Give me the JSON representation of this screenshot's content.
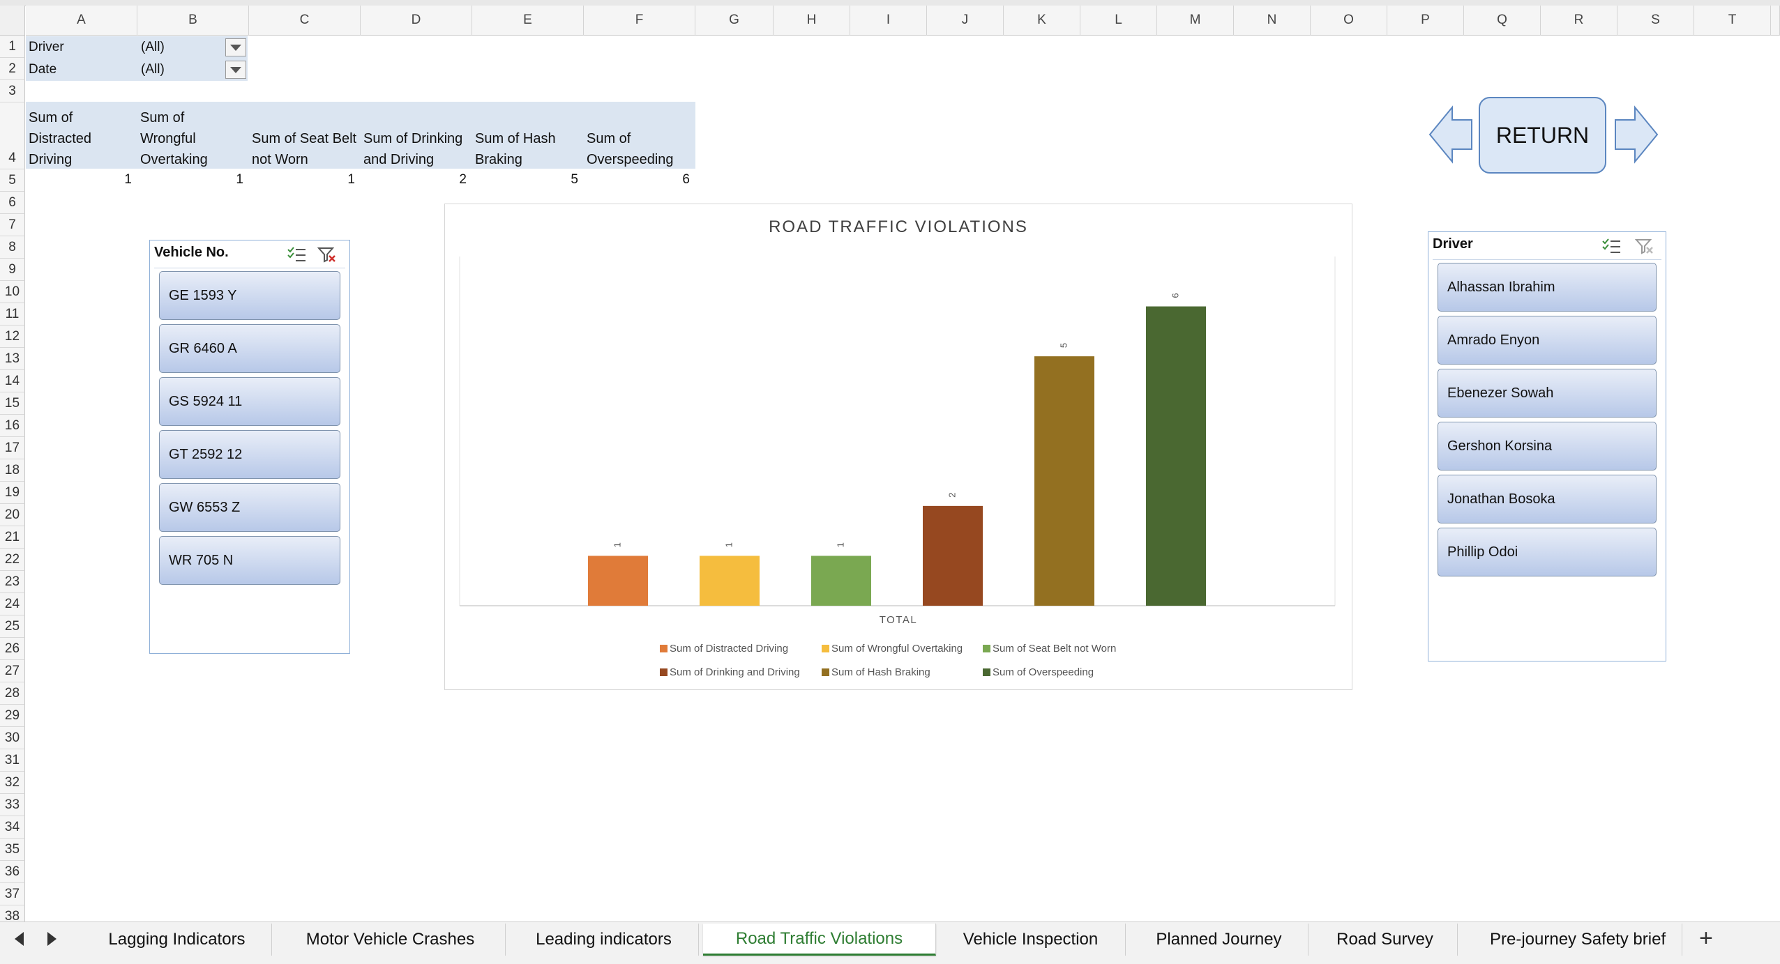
{
  "columns": [
    "A",
    "B",
    "C",
    "D",
    "E",
    "F",
    "G",
    "H",
    "I",
    "J",
    "K",
    "L",
    "M",
    "N",
    "O",
    "P",
    "Q",
    "R",
    "S",
    "T"
  ],
  "rows": [
    "1",
    "2",
    "3",
    "4",
    "5",
    "6",
    "7",
    "8",
    "9",
    "10",
    "11",
    "12",
    "13",
    "14",
    "15",
    "16",
    "17",
    "18",
    "19",
    "20",
    "21",
    "22",
    "23",
    "24",
    "25",
    "26",
    "27",
    "28",
    "29",
    "30",
    "31",
    "32",
    "33",
    "34",
    "35",
    "36",
    "37",
    "38"
  ],
  "filters": [
    {
      "label": "Driver",
      "value": "(All)"
    },
    {
      "label": "Date",
      "value": "(All)"
    }
  ],
  "pivot": {
    "headers": [
      "Sum of Distracted Driving",
      "Sum of Wrongful Overtaking",
      "Sum of Seat Belt not Worn",
      "Sum of Drinking and Driving",
      "Sum of Hash Braking",
      "Sum of Overspeeding"
    ],
    "header_lines": [
      [
        "Sum of",
        "Distracted",
        "Driving"
      ],
      [
        "Sum of",
        "Wrongful",
        "Overtaking"
      ],
      [
        "Sum of Seat Belt",
        "not Worn"
      ],
      [
        "Sum of Drinking",
        "and Driving"
      ],
      [
        "Sum of Hash",
        "Braking"
      ],
      [
        "Sum of",
        "Overspeeding"
      ]
    ],
    "values": [
      "1",
      "1",
      "1",
      "2",
      "5",
      "6"
    ]
  },
  "return_button": {
    "label": "RETURN"
  },
  "vehicle_slicer": {
    "title": "Vehicle No.",
    "items": [
      "GE 1593 Y",
      "GR 6460 A",
      "GS 5924 11",
      "GT 2592  12",
      "GW 6553 Z",
      "WR 705 N"
    ]
  },
  "driver_slicer": {
    "title": "Driver",
    "items": [
      "Alhassan Ibrahim",
      "Amrado Enyon",
      "Ebenezer Sowah",
      "Gershon Korsina",
      "Jonathan Bosoka",
      "Phillip Odoi"
    ]
  },
  "chart_data": {
    "type": "bar",
    "title": "ROAD TRAFFIC VIOLATIONS",
    "categories": [
      "TOTAL"
    ],
    "xlabel": "TOTAL",
    "ylabel": "",
    "ylim": [
      0,
      7
    ],
    "grid": false,
    "legend": "bottom",
    "series": [
      {
        "name": "Sum of  Distracted Driving",
        "values": [
          1
        ],
        "color": "#e07b39"
      },
      {
        "name": "Sum of  Wrongful Overtaking",
        "values": [
          1
        ],
        "color": "#f5bd3e"
      },
      {
        "name": "Sum of  Seat Belt not Worn",
        "values": [
          1
        ],
        "color": "#7aa851"
      },
      {
        "name": "Sum of  Drinking and Driving",
        "values": [
          2
        ],
        "color": "#964820"
      },
      {
        "name": "Sum of  Hash Braking",
        "values": [
          5
        ],
        "color": "#937021"
      },
      {
        "name": "Sum of  Overspeeding",
        "values": [
          6
        ],
        "color": "#4a6831"
      }
    ]
  },
  "tabs": {
    "items": [
      "Lagging Indicators",
      "Motor Vehicle Crashes",
      "Leading indicators",
      "Road Traffic Violations",
      "Vehicle Inspection",
      "Planned Journey",
      "Road Survey",
      "Pre-journey Safety brief"
    ],
    "active": "Road Traffic Violations",
    "add_label": "+",
    "colors": {
      "active_text": "#2e7d32"
    }
  },
  "icons": {
    "prev": "triangle-left-icon",
    "next": "triangle-right-icon",
    "multiselect": "multi-select-icon",
    "clear_filter": "clear-filter-icon"
  }
}
